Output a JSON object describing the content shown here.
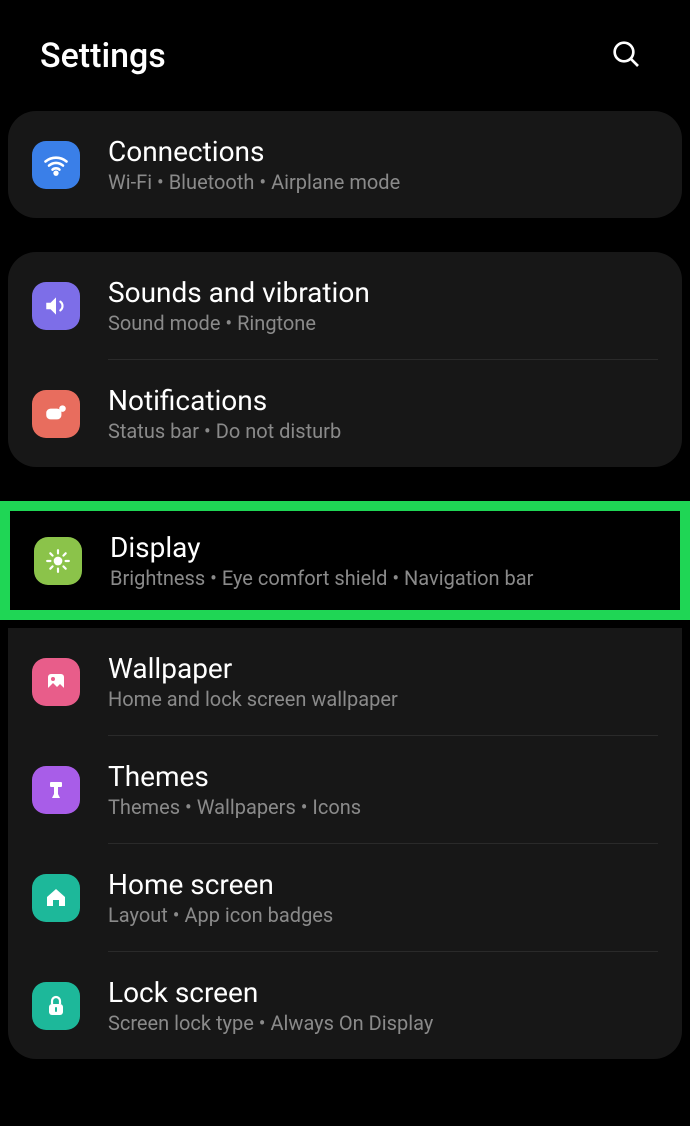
{
  "header": {
    "title": "Settings"
  },
  "groups": [
    {
      "items": [
        {
          "id": "connections",
          "title": "Connections",
          "subtitle": "Wi-Fi  •  Bluetooth  •  Airplane mode"
        }
      ]
    },
    {
      "items": [
        {
          "id": "sounds",
          "title": "Sounds and vibration",
          "subtitle": "Sound mode  •  Ringtone"
        },
        {
          "id": "notifications",
          "title": "Notifications",
          "subtitle": "Status bar  •  Do not disturb"
        }
      ]
    },
    {
      "highlighted": true,
      "items": [
        {
          "id": "display",
          "title": "Display",
          "subtitle": "Brightness  •  Eye comfort shield  •  Navigation bar"
        }
      ]
    },
    {
      "items": [
        {
          "id": "wallpaper",
          "title": "Wallpaper",
          "subtitle": "Home and lock screen wallpaper"
        },
        {
          "id": "themes",
          "title": "Themes",
          "subtitle": "Themes  •  Wallpapers  •  Icons"
        },
        {
          "id": "homescreen",
          "title": "Home screen",
          "subtitle": "Layout  •  App icon badges"
        },
        {
          "id": "lockscreen",
          "title": "Lock screen",
          "subtitle": "Screen lock type  •  Always On Display"
        }
      ]
    }
  ]
}
